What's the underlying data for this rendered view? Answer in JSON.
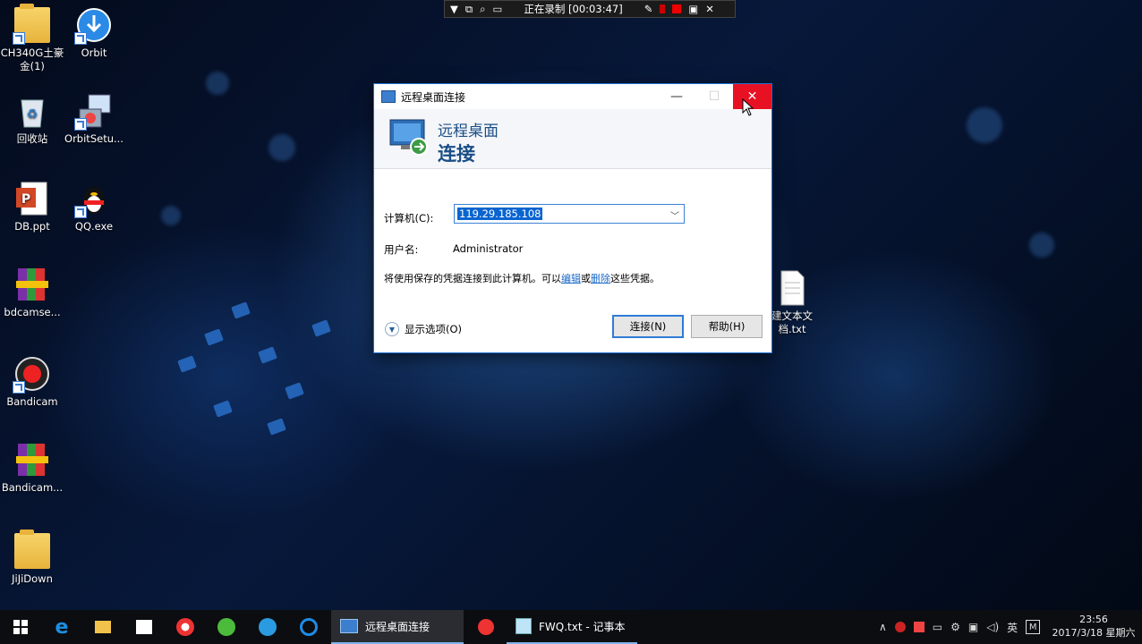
{
  "recording_bar": {
    "status": "正在录制 [00:03:47]"
  },
  "desktop_icons": [
    {
      "label": "CH340G土豪金(1)",
      "icon": "folder-icon"
    },
    {
      "label": "Orbit",
      "icon": "orbit-download-icon"
    },
    {
      "label": "回收站",
      "icon": "recycle-bin-icon"
    },
    {
      "label": "OrbitSetu...",
      "icon": "installer-icon"
    },
    {
      "label": "DB.ppt",
      "icon": "powerpoint-file-icon"
    },
    {
      "label": "QQ.exe",
      "icon": "qq-penguin-icon"
    },
    {
      "label": "bdcamse...",
      "icon": "winrar-archive-icon"
    },
    {
      "label": "Bandicam",
      "icon": "bandicam-icon"
    },
    {
      "label": "Bandicam...",
      "icon": "winrar-archive-icon"
    },
    {
      "label": "JiJiDown",
      "icon": "folder-icon"
    },
    {
      "label": "建文本文档.txt",
      "icon": "text-file-icon"
    }
  ],
  "dialog": {
    "title": "远程桌面连接",
    "banner_line1": "远程桌面",
    "banner_line2": "连接",
    "computer_label": "计算机(C):",
    "computer_value": "119.29.185.108",
    "username_label": "用户名:",
    "username_value": "Administrator",
    "info_text_pre": "将使用保存的凭据连接到此计算机。可以",
    "info_link_edit": "编辑",
    "info_text_mid": "或",
    "info_link_delete": "删除",
    "info_text_post": "这些凭据。",
    "show_options": "显示选项(O)",
    "connect_button": "连接(N)",
    "help_button": "帮助(H)"
  },
  "taskbar": {
    "active_app": "远程桌面连接",
    "notepad_app": "FWQ.txt - 记事本",
    "ime": "英",
    "time": "23:56",
    "date": "2017/3/18 星期六"
  },
  "colors": {
    "accent": "#1f6fd1",
    "close_red": "#e81123",
    "title_blue": "#1a4e86"
  }
}
